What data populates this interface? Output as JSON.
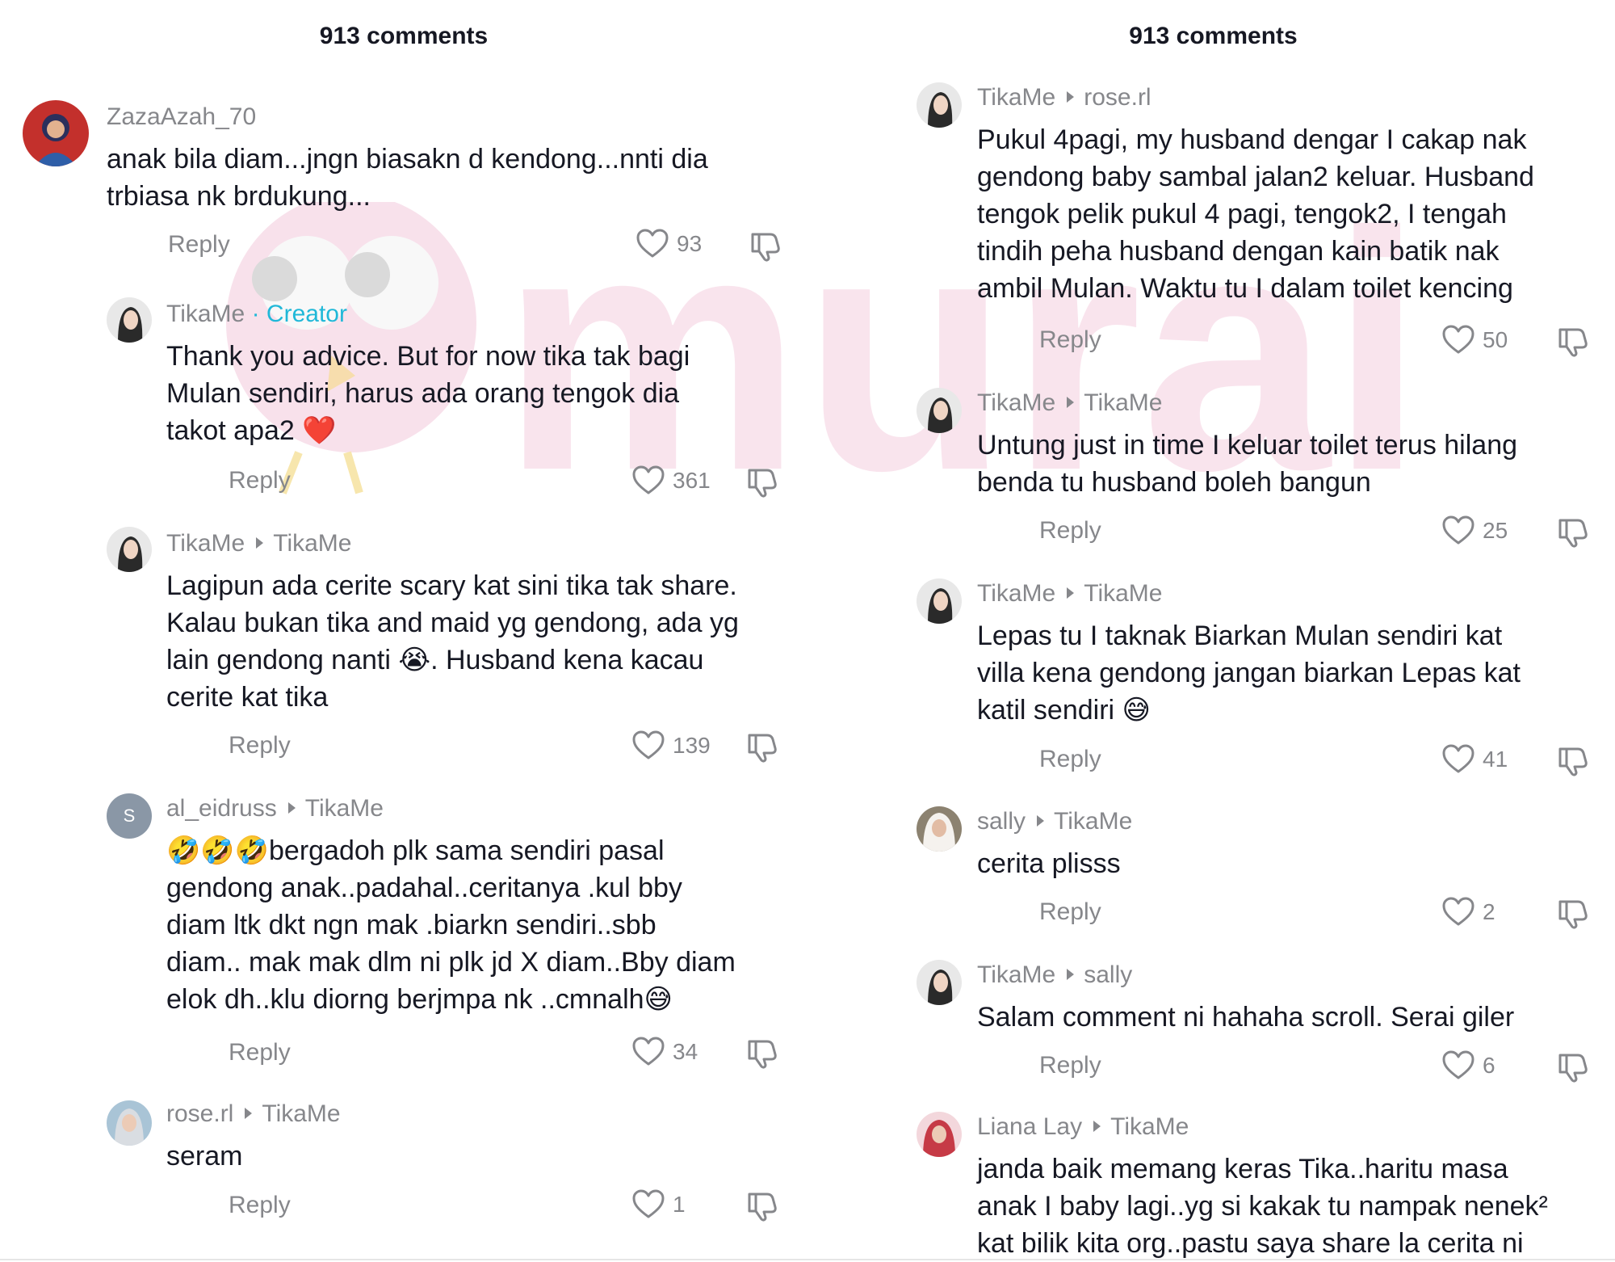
{
  "watermark": {
    "text": "murai",
    "color": "#f5cfe0"
  },
  "left_panel": {
    "title": "913 comments",
    "comments": [
      {
        "user": "ZazaAzah_70",
        "reply_to": "",
        "creator_label": "",
        "text": "anak bila diam...jngn biasakn d kendong...nnti dia\ntrbiasa nk brdukung...",
        "reply": "Reply",
        "likes": "93",
        "avatar": "uniform-photo-avatar"
      },
      {
        "user": "TikaMe",
        "reply_to": "",
        "creator_label": "· Creator",
        "text": "Thank you advice. But for now tika tak bagi\nMulan sendiri, harus ada orang tengok dia\ntakot apa2 ❤️",
        "reply": "Reply",
        "likes": "361",
        "avatar": "woman-photo-avatar"
      },
      {
        "user": "TikaMe",
        "reply_to": "TikaMe",
        "creator_label": "",
        "text": "Lagipun ada cerite scary kat sini tika tak share.\nKalau bukan tika and maid yg gendong, ada yg\nlain gendong nanti 😭. Husband kena kacau\ncerite kat tika",
        "reply": "Reply",
        "likes": "139",
        "avatar": "woman-photo-avatar"
      },
      {
        "user": "al_eidruss",
        "reply_to": "TikaMe",
        "creator_label": "",
        "text": "🤣🤣🤣bergadoh plk sama sendiri pasal\ngendong anak..padahal..ceritanya .kul bby\ndiam ltk dkt ngn mak .biarkn sendiri..sbb\ndiam.. mak mak dlm ni plk jd X diam..Bby diam\nelok dh..klu diorng berjmpa nk ..cmnalh😅",
        "reply": "Reply",
        "likes": "34",
        "avatar": "letter-avatar",
        "avatar_letter": "S"
      },
      {
        "user": "rose.rl",
        "reply_to": "TikaMe",
        "creator_label": "",
        "text": "seram",
        "reply": "Reply",
        "likes": "1",
        "avatar": "hijab-photo-avatar"
      }
    ]
  },
  "right_panel": {
    "title": "913 comments",
    "comments": [
      {
        "user": "TikaMe",
        "reply_to": "rose.rl",
        "text": "Pukul 4pagi, my husband dengar I cakap nak\ngendong baby sambal jalan2 keluar. Husband\ntengok pelik pukul 4 pagi, tengok2, I tengah\ntindih peha husband dengan kain batik nak\nambil Mulan. Waktu tu I dalam toilet kencing",
        "reply": "Reply",
        "likes": "50",
        "avatar": "woman-photo-avatar"
      },
      {
        "user": "TikaMe",
        "reply_to": "TikaMe",
        "text": "Untung just in time I keluar toilet terus hilang\nbenda tu husband boleh bangun",
        "reply": "Reply",
        "likes": "25",
        "avatar": "woman-photo-avatar"
      },
      {
        "user": "TikaMe",
        "reply_to": "TikaMe",
        "text": "Lepas tu I taknak Biarkan Mulan sendiri kat\nvilla kena gendong jangan biarkan Lepas kat\nkatil sendiri 😅",
        "reply": "Reply",
        "likes": "41",
        "avatar": "woman-photo-avatar"
      },
      {
        "user": "sally",
        "reply_to": "TikaMe",
        "text": "cerita plisss",
        "reply": "Reply",
        "likes": "2",
        "avatar": "hijab-white-photo-avatar"
      },
      {
        "user": "TikaMe",
        "reply_to": "sally",
        "text": "Salam comment ni hahaha scroll. Serai giler",
        "reply": "Reply",
        "likes": "6",
        "avatar": "woman-photo-avatar"
      },
      {
        "user": "Liana Lay",
        "reply_to": "TikaMe",
        "text": "janda baik memang keras Tika..haritu masa\nanak I baby lagi..yg si kakak tu nampak nenek²\nkat bilik kita org..pastu saya share la cerita ni",
        "reply": "",
        "likes": "",
        "avatar": "red-hijab-photo-avatar"
      }
    ]
  }
}
